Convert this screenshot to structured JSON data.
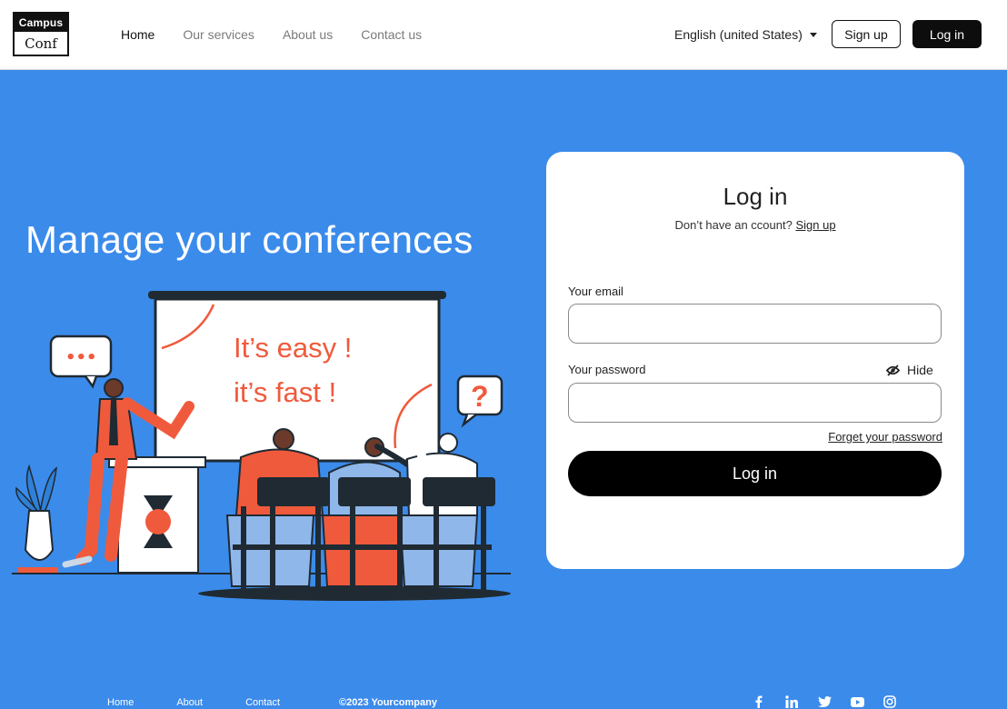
{
  "header": {
    "logo": {
      "top": "Campus",
      "bottom": "Conf"
    },
    "nav": [
      "Home",
      "Our services",
      "About us",
      "Contact us"
    ],
    "language": "English (united States)",
    "signup_label": "Sign up",
    "login_label": "Log in"
  },
  "hero": {
    "title": "Manage your conferences",
    "board_line1": "It’s easy !",
    "board_line2": "it’s fast !",
    "bubble_left": "•••",
    "bubble_right": "?"
  },
  "login": {
    "title": "Log in",
    "subtitle_text": "Don’t have an ccount?",
    "subtitle_link": "Sign up",
    "email_label": "Your email",
    "email_value": "",
    "password_label": "Your password",
    "password_value": "",
    "hide_label": "Hide",
    "forgot_label": "Forget your password",
    "submit_label": "Log in"
  },
  "footer": {
    "links": [
      "Home",
      "About",
      "Contact"
    ],
    "copyright": "©2023 Yourcompany",
    "social_icons": [
      "facebook-icon",
      "linkedin-icon",
      "twitter-icon",
      "youtube-icon",
      "instagram-icon"
    ]
  },
  "colors": {
    "background": "#3b8beb",
    "accent": "#f05a3c",
    "dark": "#000000"
  }
}
